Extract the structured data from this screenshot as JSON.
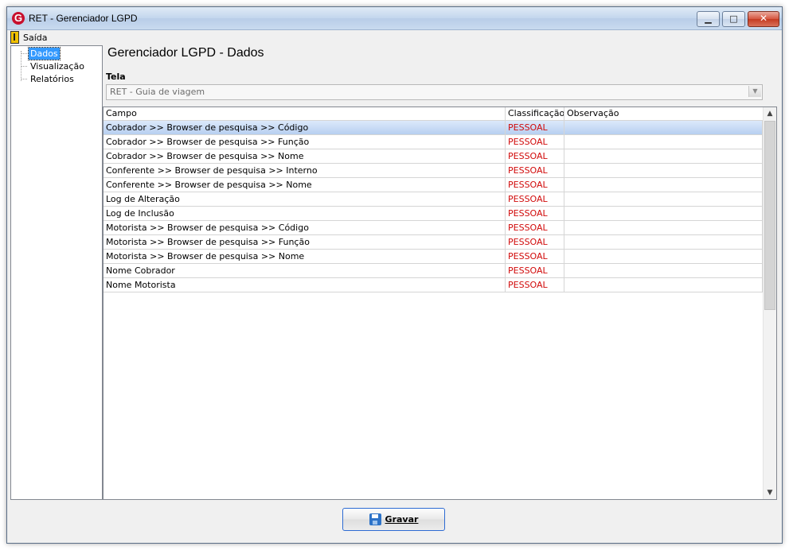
{
  "window": {
    "title": "RET - Gerenciador LGPD",
    "icons": {
      "app": "app-logo-icon",
      "minimize": "minimize-icon",
      "maximize": "maximize-icon",
      "close": "close-icon"
    }
  },
  "menu": {
    "exit_label": "Saída",
    "exit_icon": "exit-door-icon"
  },
  "tree": {
    "items": [
      {
        "label": "Dados",
        "selected": true
      },
      {
        "label": "Visualização",
        "selected": false
      },
      {
        "label": "Relatórios",
        "selected": false
      }
    ]
  },
  "main": {
    "title": "Gerenciador LGPD - Dados",
    "screen_label": "Tela",
    "screen_value": "RET - Guia de viagem"
  },
  "table": {
    "columns": [
      "Campo",
      "Classificação",
      "Observação"
    ],
    "rows": [
      {
        "campo": "Cobrador >> Browser de pesquisa >> Código",
        "classificacao": "PESSOAL",
        "observacao": ""
      },
      {
        "campo": "Cobrador >> Browser de pesquisa >> Função",
        "classificacao": "PESSOAL",
        "observacao": ""
      },
      {
        "campo": "Cobrador >> Browser de pesquisa >> Nome",
        "classificacao": "PESSOAL",
        "observacao": ""
      },
      {
        "campo": "Conferente >> Browser de pesquisa >> Interno",
        "classificacao": "PESSOAL",
        "observacao": ""
      },
      {
        "campo": "Conferente >> Browser de pesquisa >> Nome",
        "classificacao": "PESSOAL",
        "observacao": ""
      },
      {
        "campo": "Log de Alteração",
        "classificacao": "PESSOAL",
        "observacao": ""
      },
      {
        "campo": "Log de Inclusão",
        "classificacao": "PESSOAL",
        "observacao": ""
      },
      {
        "campo": "Motorista >> Browser de pesquisa >> Código",
        "classificacao": "PESSOAL",
        "observacao": ""
      },
      {
        "campo": "Motorista >> Browser de pesquisa >> Função",
        "classificacao": "PESSOAL",
        "observacao": ""
      },
      {
        "campo": "Motorista >> Browser de pesquisa >> Nome",
        "classificacao": "PESSOAL",
        "observacao": ""
      },
      {
        "campo": "Nome Cobrador",
        "classificacao": "PESSOAL",
        "observacao": ""
      },
      {
        "campo": "Nome Motorista",
        "classificacao": "PESSOAL",
        "observacao": ""
      }
    ],
    "selected_row": 0
  },
  "footer": {
    "save_label": "Gravar",
    "save_icon": "floppy-disk-icon"
  },
  "colors": {
    "accent": "#3399ff",
    "classification": "#d10a0a",
    "selected_row": "#b7cff0"
  }
}
